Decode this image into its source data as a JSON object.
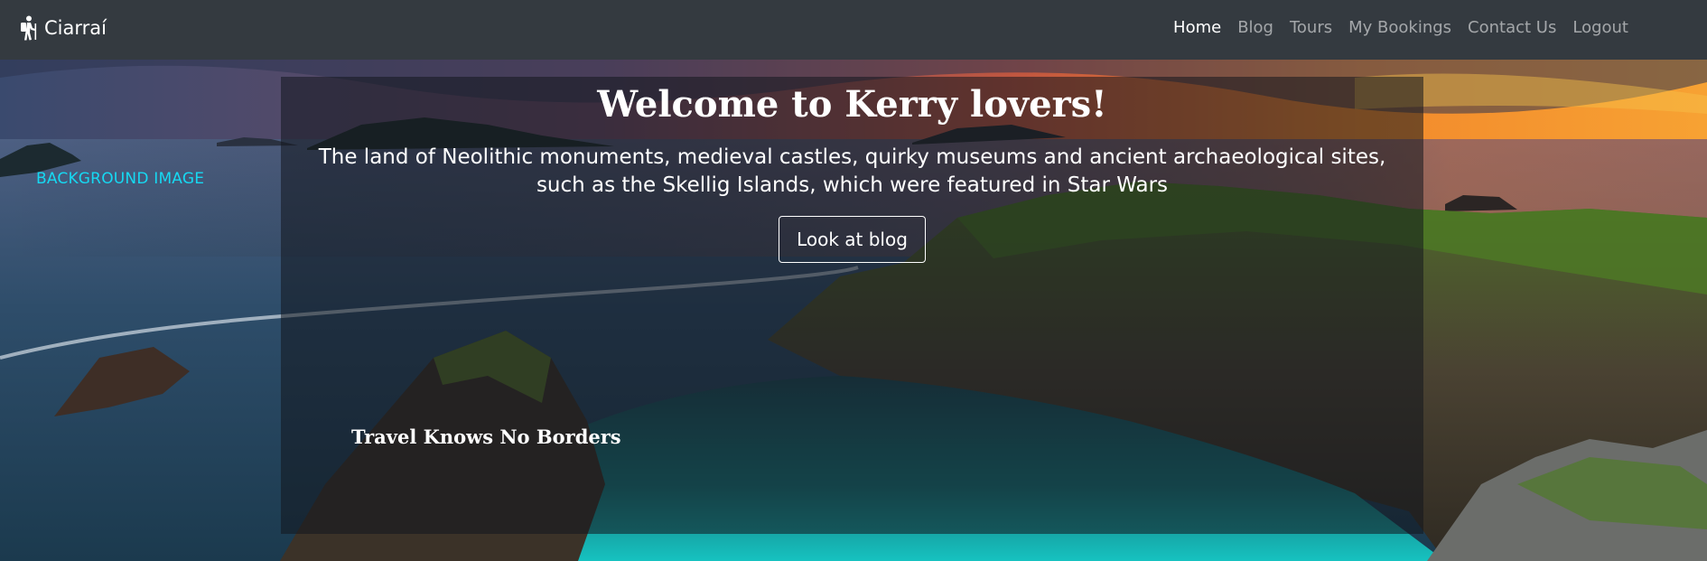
{
  "navbar": {
    "brand": {
      "text": "Ciarraí",
      "icon": "hiker-icon"
    },
    "links": [
      {
        "label": "Home",
        "active": true
      },
      {
        "label": "Blog",
        "active": false
      },
      {
        "label": "Tours",
        "active": false
      },
      {
        "label": "My Bookings",
        "active": false
      },
      {
        "label": "Contact Us",
        "active": false
      },
      {
        "label": "Logout",
        "active": false
      }
    ]
  },
  "hero": {
    "background_label": "BACKGROUND IMAGE",
    "title": "Welcome to Kerry lovers!",
    "subtitle": "The land of Neolithic monuments, medieval castles, quirky museums and ancient archaeological sites, such as the Skellig Islands, which were featured in Star Wars",
    "button_label": "Look at blog",
    "tagline": "Travel Knows No Borders"
  },
  "colors": {
    "navbar_bg": "#343a40",
    "nav_active": "#ffffff",
    "nav_inactive": "#a0a3a6",
    "background_label": "#16d9f2",
    "overlay": "#12161e"
  }
}
